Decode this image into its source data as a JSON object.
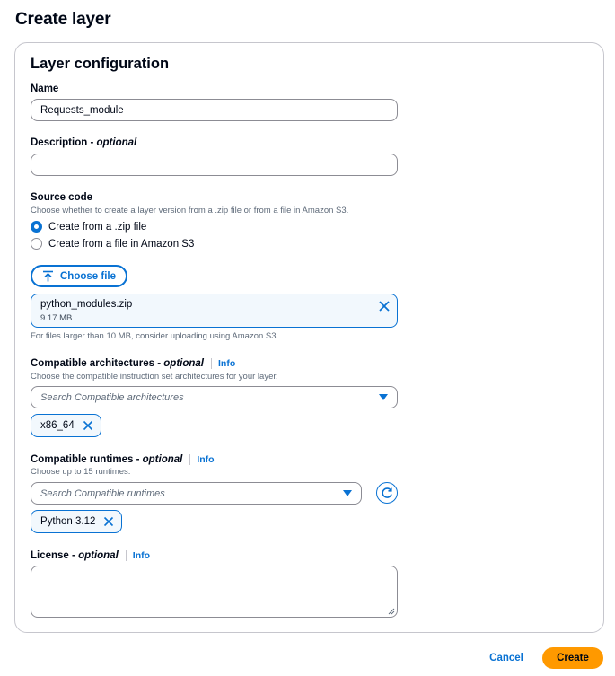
{
  "page": {
    "title": "Create layer"
  },
  "config": {
    "title": "Layer configuration",
    "name": {
      "label": "Name",
      "value": "Requests_module"
    },
    "description": {
      "label": "Description",
      "optional": "optional",
      "value": ""
    },
    "source_code": {
      "label": "Source code",
      "description": "Choose whether to create a layer version from a .zip file or from a file in Amazon S3.",
      "options": [
        {
          "label": "Create from a .zip file",
          "checked": true
        },
        {
          "label": "Create from a file in Amazon S3",
          "checked": false
        }
      ],
      "choose_file_label": "Choose file",
      "file": {
        "name": "python_modules.zip",
        "size": "9.17 MB"
      },
      "hint": "For files larger than 10 MB, consider uploading using Amazon S3."
    },
    "architectures": {
      "label": "Compatible architectures",
      "optional": "optional",
      "info": "Info",
      "description": "Choose the compatible instruction set architectures for your layer.",
      "placeholder": "Search Compatible architectures",
      "selected": [
        "x86_64"
      ]
    },
    "runtimes": {
      "label": "Compatible runtimes",
      "optional": "optional",
      "info": "Info",
      "description": "Choose up to 15 runtimes.",
      "placeholder": "Search Compatible runtimes",
      "selected": [
        "Python 3.12"
      ]
    },
    "license": {
      "label": "License",
      "optional": "optional",
      "info": "Info",
      "value": ""
    }
  },
  "actions": {
    "cancel_label": "Cancel",
    "create_label": "Create"
  },
  "colors": {
    "accent": "#0972d3",
    "primary_button": "#ff9900",
    "border": "#8c8c94"
  },
  "icons": {
    "upload": "upload-icon",
    "close": "close-icon",
    "caret": "caret-down-icon",
    "refresh": "refresh-icon"
  }
}
